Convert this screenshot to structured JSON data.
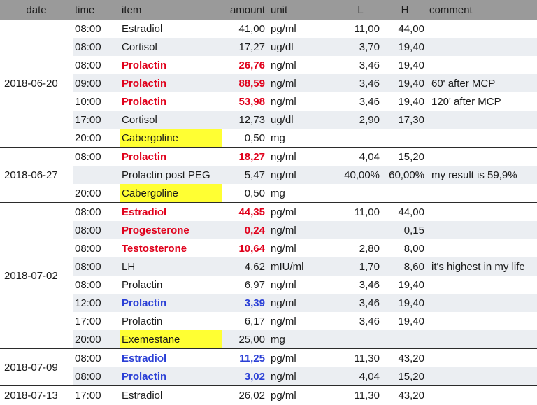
{
  "header": {
    "date": "date",
    "time": "time",
    "item": "item",
    "amount": "amount",
    "unit": "unit",
    "L": "L",
    "H": "H",
    "comment": "comment"
  },
  "colors": {
    "header_bg": "#9a9a9a",
    "row_alt_bg": "#ebeef2",
    "high_value": "#e0001b",
    "low_value": "#2a3fd6",
    "medication_highlight": "#ffff33"
  },
  "groups": [
    {
      "date": "2018-06-20",
      "rows": [
        {
          "time": "08:00",
          "item": "Estradiol",
          "amount": "41,00",
          "unit": "pg/ml",
          "L": "11,00",
          "H": "44,00",
          "comment": "",
          "status": "normal"
        },
        {
          "time": "08:00",
          "item": "Cortisol",
          "amount": "17,27",
          "unit": "ug/dl",
          "L": "3,70",
          "H": "19,40",
          "comment": "",
          "status": "normal"
        },
        {
          "time": "08:00",
          "item": "Prolactin",
          "amount": "26,76",
          "unit": "ng/ml",
          "L": "3,46",
          "H": "19,40",
          "comment": "",
          "status": "high"
        },
        {
          "time": "09:00",
          "item": "Prolactin",
          "amount": "88,59",
          "unit": "ng/ml",
          "L": "3,46",
          "H": "19,40",
          "comment": "60' after MCP",
          "status": "high"
        },
        {
          "time": "10:00",
          "item": "Prolactin",
          "amount": "53,98",
          "unit": "ng/ml",
          "L": "3,46",
          "H": "19,40",
          "comment": "120' after MCP",
          "status": "high"
        },
        {
          "time": "17:00",
          "item": "Cortisol",
          "amount": "12,73",
          "unit": "ug/dl",
          "L": "2,90",
          "H": "17,30",
          "comment": "",
          "status": "normal"
        },
        {
          "time": "20:00",
          "item": "Cabergoline",
          "amount": "0,50",
          "unit": "mg",
          "L": "",
          "H": "",
          "comment": "",
          "status": "medication"
        }
      ]
    },
    {
      "date": "2018-06-27",
      "rows": [
        {
          "time": "08:00",
          "item": "Prolactin",
          "amount": "18,27",
          "unit": "ng/ml",
          "L": "4,04",
          "H": "15,20",
          "comment": "",
          "status": "high"
        },
        {
          "time": "",
          "item": "Prolactin post PEG",
          "amount": "5,47",
          "unit": "ng/ml",
          "L": "40,00%",
          "H": "60,00%",
          "comment": "my result is 59,9%",
          "status": "normal"
        },
        {
          "time": "20:00",
          "item": "Cabergoline",
          "amount": "0,50",
          "unit": "mg",
          "L": "",
          "H": "",
          "comment": "",
          "status": "medication"
        }
      ]
    },
    {
      "date": "2018-07-02",
      "rows": [
        {
          "time": "08:00",
          "item": "Estradiol",
          "amount": "44,35",
          "unit": "pg/ml",
          "L": "11,00",
          "H": "44,00",
          "comment": "",
          "status": "high"
        },
        {
          "time": "08:00",
          "item": "Progesterone",
          "amount": "0,24",
          "unit": "ng/ml",
          "L": "",
          "H": "0,15",
          "comment": "",
          "status": "high"
        },
        {
          "time": "08:00",
          "item": "Testosterone",
          "amount": "10,64",
          "unit": "ng/ml",
          "L": "2,80",
          "H": "8,00",
          "comment": "",
          "status": "high"
        },
        {
          "time": "08:00",
          "item": "LH",
          "amount": "4,62",
          "unit": "mIU/ml",
          "L": "1,70",
          "H": "8,60",
          "comment": "it's highest in my life",
          "status": "normal"
        },
        {
          "time": "08:00",
          "item": "Prolactin",
          "amount": "6,97",
          "unit": "ng/ml",
          "L": "3,46",
          "H": "19,40",
          "comment": "",
          "status": "normal"
        },
        {
          "time": "12:00",
          "item": "Prolactin",
          "amount": "3,39",
          "unit": "ng/ml",
          "L": "3,46",
          "H": "19,40",
          "comment": "",
          "status": "low"
        },
        {
          "time": "17:00",
          "item": "Prolactin",
          "amount": "6,17",
          "unit": "ng/ml",
          "L": "3,46",
          "H": "19,40",
          "comment": "",
          "status": "normal"
        },
        {
          "time": "20:00",
          "item": "Exemestane",
          "amount": "25,00",
          "unit": "mg",
          "L": "",
          "H": "",
          "comment": "",
          "status": "medication"
        }
      ]
    },
    {
      "date": "2018-07-09",
      "rows": [
        {
          "time": "08:00",
          "item": "Estradiol",
          "amount": "11,25",
          "unit": "pg/ml",
          "L": "11,30",
          "H": "43,20",
          "comment": "",
          "status": "low"
        },
        {
          "time": "08:00",
          "item": "Prolactin",
          "amount": "3,02",
          "unit": "ng/ml",
          "L": "4,04",
          "H": "15,20",
          "comment": "",
          "status": "low"
        }
      ]
    },
    {
      "date": "2018-07-13",
      "rows": [
        {
          "time": "17:00",
          "item": "Estradiol",
          "amount": "26,02",
          "unit": "pg/ml",
          "L": "11,30",
          "H": "43,20",
          "comment": "",
          "status": "normal"
        }
      ]
    }
  ]
}
